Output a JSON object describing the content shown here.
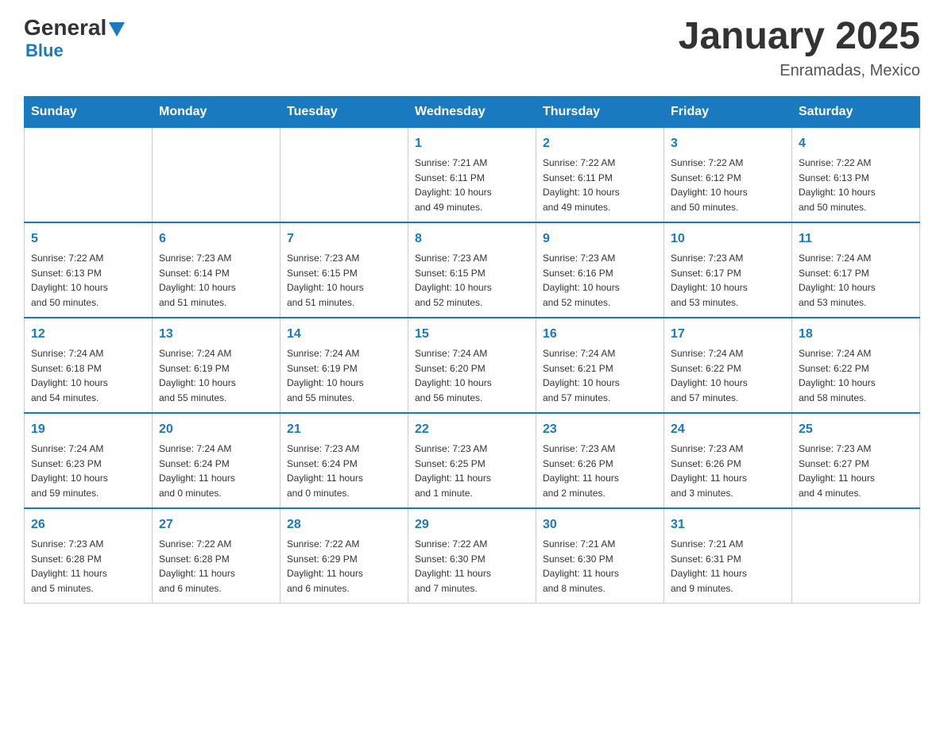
{
  "logo": {
    "general": "General",
    "blue": "Blue"
  },
  "header": {
    "title": "January 2025",
    "subtitle": "Enramadas, Mexico"
  },
  "weekdays": [
    "Sunday",
    "Monday",
    "Tuesday",
    "Wednesday",
    "Thursday",
    "Friday",
    "Saturday"
  ],
  "weeks": [
    [
      {
        "day": "",
        "info": ""
      },
      {
        "day": "",
        "info": ""
      },
      {
        "day": "",
        "info": ""
      },
      {
        "day": "1",
        "info": "Sunrise: 7:21 AM\nSunset: 6:11 PM\nDaylight: 10 hours\nand 49 minutes."
      },
      {
        "day": "2",
        "info": "Sunrise: 7:22 AM\nSunset: 6:11 PM\nDaylight: 10 hours\nand 49 minutes."
      },
      {
        "day": "3",
        "info": "Sunrise: 7:22 AM\nSunset: 6:12 PM\nDaylight: 10 hours\nand 50 minutes."
      },
      {
        "day": "4",
        "info": "Sunrise: 7:22 AM\nSunset: 6:13 PM\nDaylight: 10 hours\nand 50 minutes."
      }
    ],
    [
      {
        "day": "5",
        "info": "Sunrise: 7:22 AM\nSunset: 6:13 PM\nDaylight: 10 hours\nand 50 minutes."
      },
      {
        "day": "6",
        "info": "Sunrise: 7:23 AM\nSunset: 6:14 PM\nDaylight: 10 hours\nand 51 minutes."
      },
      {
        "day": "7",
        "info": "Sunrise: 7:23 AM\nSunset: 6:15 PM\nDaylight: 10 hours\nand 51 minutes."
      },
      {
        "day": "8",
        "info": "Sunrise: 7:23 AM\nSunset: 6:15 PM\nDaylight: 10 hours\nand 52 minutes."
      },
      {
        "day": "9",
        "info": "Sunrise: 7:23 AM\nSunset: 6:16 PM\nDaylight: 10 hours\nand 52 minutes."
      },
      {
        "day": "10",
        "info": "Sunrise: 7:23 AM\nSunset: 6:17 PM\nDaylight: 10 hours\nand 53 minutes."
      },
      {
        "day": "11",
        "info": "Sunrise: 7:24 AM\nSunset: 6:17 PM\nDaylight: 10 hours\nand 53 minutes."
      }
    ],
    [
      {
        "day": "12",
        "info": "Sunrise: 7:24 AM\nSunset: 6:18 PM\nDaylight: 10 hours\nand 54 minutes."
      },
      {
        "day": "13",
        "info": "Sunrise: 7:24 AM\nSunset: 6:19 PM\nDaylight: 10 hours\nand 55 minutes."
      },
      {
        "day": "14",
        "info": "Sunrise: 7:24 AM\nSunset: 6:19 PM\nDaylight: 10 hours\nand 55 minutes."
      },
      {
        "day": "15",
        "info": "Sunrise: 7:24 AM\nSunset: 6:20 PM\nDaylight: 10 hours\nand 56 minutes."
      },
      {
        "day": "16",
        "info": "Sunrise: 7:24 AM\nSunset: 6:21 PM\nDaylight: 10 hours\nand 57 minutes."
      },
      {
        "day": "17",
        "info": "Sunrise: 7:24 AM\nSunset: 6:22 PM\nDaylight: 10 hours\nand 57 minutes."
      },
      {
        "day": "18",
        "info": "Sunrise: 7:24 AM\nSunset: 6:22 PM\nDaylight: 10 hours\nand 58 minutes."
      }
    ],
    [
      {
        "day": "19",
        "info": "Sunrise: 7:24 AM\nSunset: 6:23 PM\nDaylight: 10 hours\nand 59 minutes."
      },
      {
        "day": "20",
        "info": "Sunrise: 7:24 AM\nSunset: 6:24 PM\nDaylight: 11 hours\nand 0 minutes."
      },
      {
        "day": "21",
        "info": "Sunrise: 7:23 AM\nSunset: 6:24 PM\nDaylight: 11 hours\nand 0 minutes."
      },
      {
        "day": "22",
        "info": "Sunrise: 7:23 AM\nSunset: 6:25 PM\nDaylight: 11 hours\nand 1 minute."
      },
      {
        "day": "23",
        "info": "Sunrise: 7:23 AM\nSunset: 6:26 PM\nDaylight: 11 hours\nand 2 minutes."
      },
      {
        "day": "24",
        "info": "Sunrise: 7:23 AM\nSunset: 6:26 PM\nDaylight: 11 hours\nand 3 minutes."
      },
      {
        "day": "25",
        "info": "Sunrise: 7:23 AM\nSunset: 6:27 PM\nDaylight: 11 hours\nand 4 minutes."
      }
    ],
    [
      {
        "day": "26",
        "info": "Sunrise: 7:23 AM\nSunset: 6:28 PM\nDaylight: 11 hours\nand 5 minutes."
      },
      {
        "day": "27",
        "info": "Sunrise: 7:22 AM\nSunset: 6:28 PM\nDaylight: 11 hours\nand 6 minutes."
      },
      {
        "day": "28",
        "info": "Sunrise: 7:22 AM\nSunset: 6:29 PM\nDaylight: 11 hours\nand 6 minutes."
      },
      {
        "day": "29",
        "info": "Sunrise: 7:22 AM\nSunset: 6:30 PM\nDaylight: 11 hours\nand 7 minutes."
      },
      {
        "day": "30",
        "info": "Sunrise: 7:21 AM\nSunset: 6:30 PM\nDaylight: 11 hours\nand 8 minutes."
      },
      {
        "day": "31",
        "info": "Sunrise: 7:21 AM\nSunset: 6:31 PM\nDaylight: 11 hours\nand 9 minutes."
      },
      {
        "day": "",
        "info": ""
      }
    ]
  ]
}
